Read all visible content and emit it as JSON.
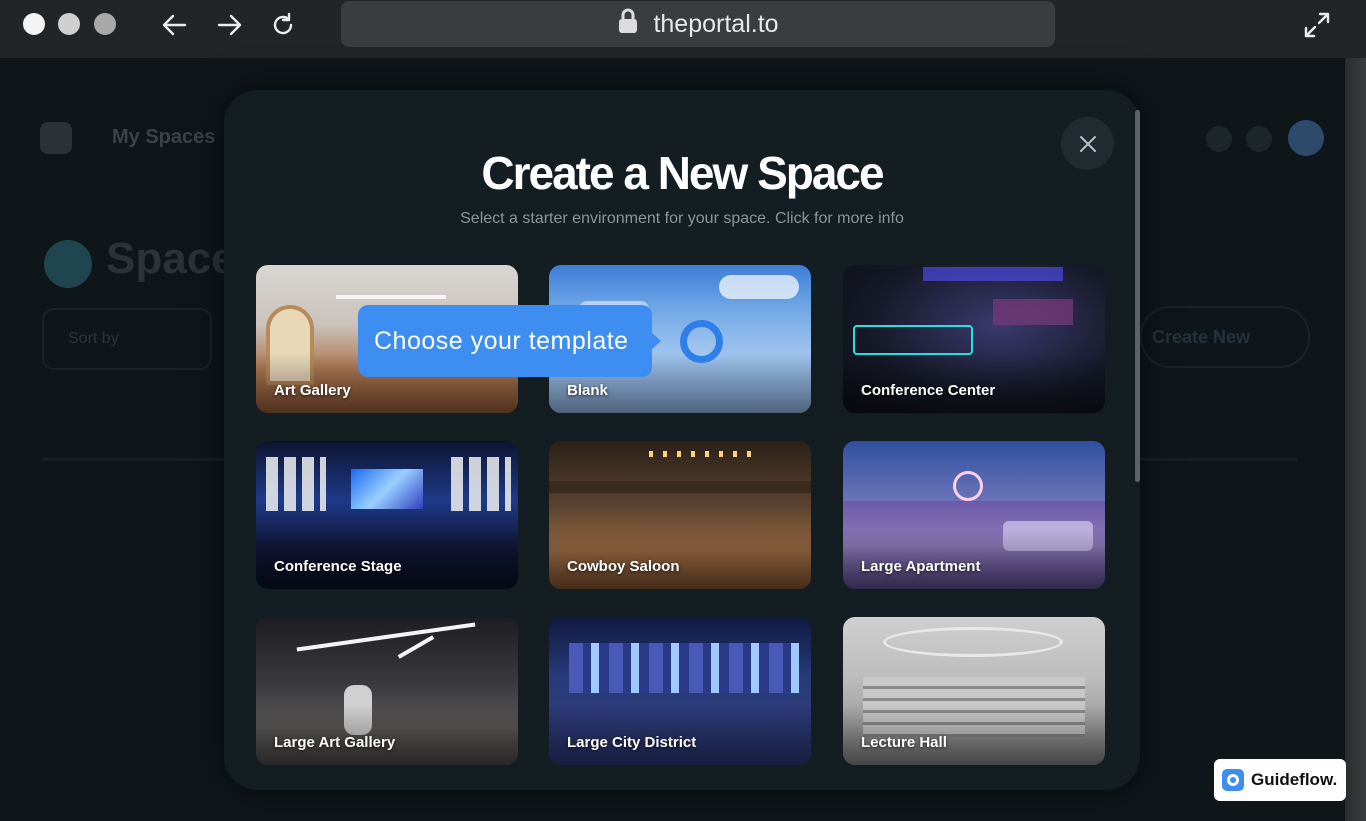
{
  "browser": {
    "url": "theportal.to",
    "buttons": {
      "back": "arrow-left-icon",
      "forward": "arrow-right-icon",
      "reload": "reload-icon",
      "fullscreen": "expand-icon"
    }
  },
  "background": {
    "nav_title": "My Spaces",
    "page_title": "Spaces",
    "filter_label": "Sort by",
    "right_button": "Create New"
  },
  "modal": {
    "title": "Create a New Space",
    "subtitle": "Select a starter environment for your space. Click for more info",
    "templates": [
      {
        "name": "Art Gallery"
      },
      {
        "name": "Blank"
      },
      {
        "name": "Conference Center"
      },
      {
        "name": "Conference Stage"
      },
      {
        "name": "Cowboy Saloon"
      },
      {
        "name": "Large Apartment"
      },
      {
        "name": "Large Art Gallery"
      },
      {
        "name": "Large City District"
      },
      {
        "name": "Lecture Hall"
      }
    ]
  },
  "tooltip": {
    "text": "Choose your template"
  },
  "badge": {
    "text": "Guideflow."
  },
  "colors": {
    "accent": "#3d8ef0",
    "modal_bg": "#141d22",
    "chrome_bg": "#222426"
  }
}
